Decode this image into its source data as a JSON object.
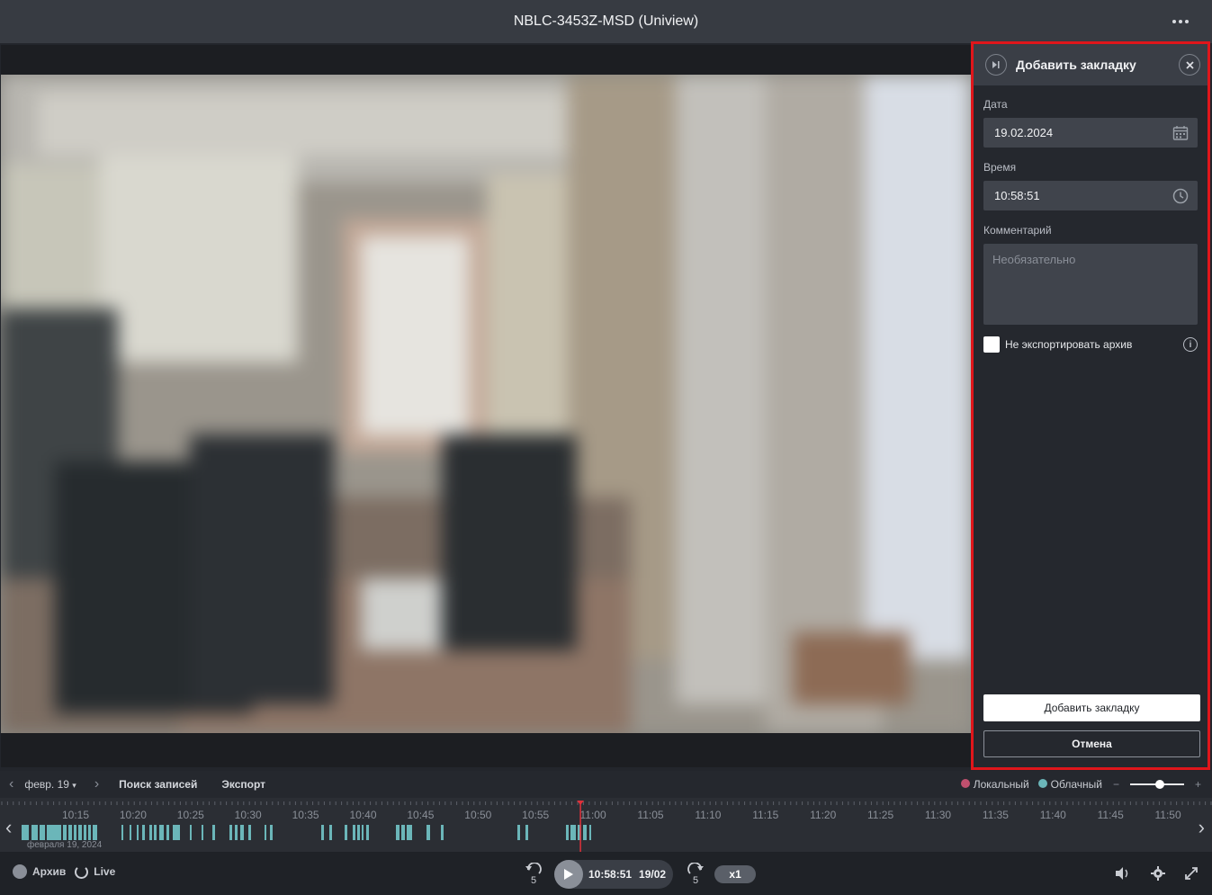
{
  "window": {
    "title": "NBLC-3453Z-MSD (Uniview)"
  },
  "bookmark_panel": {
    "title": "Добавить закладку",
    "date_label": "Дата",
    "date_value": "19.02.2024",
    "time_label": "Время",
    "time_value": "10:58:51",
    "comment_label": "Комментарий",
    "comment_placeholder": "Необязательно",
    "no_export_label": "Не экспортировать архив",
    "no_export_checked": false,
    "add_button": "Добавить закладку",
    "cancel_button": "Отмена"
  },
  "timeline_bar": {
    "date": "февр. 19",
    "search_records": "Поиск записей",
    "export": "Экспорт",
    "legend_local": "Локальный",
    "legend_cloud": "Облачный",
    "local_color": "#c0506e",
    "cloud_color": "#6bb6b9",
    "zoom_minus": "−",
    "zoom_plus": "+"
  },
  "timeline": {
    "ticks": [
      "10:15",
      "10:20",
      "10:25",
      "10:30",
      "10:35",
      "10:40",
      "10:45",
      "10:50",
      "10:55",
      "11:00",
      "11:05",
      "11:10",
      "11:15",
      "11:20",
      "11:25",
      "11:30",
      "11:35",
      "11:40",
      "11:45",
      "11:50"
    ],
    "current_time": "11:00",
    "date_label": "февраля 19, 2024"
  },
  "controls": {
    "archive_label": "Архив",
    "live_label": "Live",
    "skip_back": "5",
    "skip_forward": "5",
    "time": "10:58:51",
    "date": "19/02",
    "speed": "x1"
  },
  "icons": [
    "more-icon",
    "skip-to-end-icon",
    "close-icon",
    "calendar-icon",
    "clock-icon",
    "info-icon",
    "play-icon",
    "rewind-icon",
    "forward-icon",
    "volume-icon",
    "settings-icon",
    "fullscreen-icon",
    "chevron-left-icon",
    "chevron-right-icon",
    "caret-down-icon"
  ]
}
